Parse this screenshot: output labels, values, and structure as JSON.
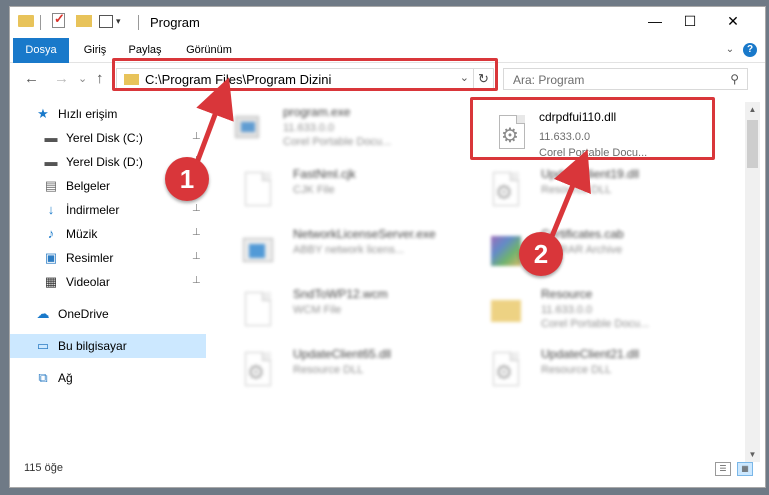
{
  "window": {
    "title": "Program",
    "minimize": "—",
    "maximize": "☐",
    "close": "✕"
  },
  "ribbon": {
    "tabs": [
      "Dosya",
      "Giriş",
      "Paylaş",
      "Görünüm"
    ],
    "expand": "⌄",
    "help": "?"
  },
  "navbar": {
    "back": "←",
    "forward": "→",
    "recent": "⌄",
    "up": "↑",
    "address": "C:\\Program Files\\Program Dizini",
    "address_dropdown": "⌄",
    "refresh": "↻",
    "search_placeholder": "Ara: Program",
    "search_icon": "⚲"
  },
  "sidebar": {
    "items": [
      {
        "label": "Hızlı erişim",
        "icon": "star-icon",
        "glyph": "★",
        "color": "#1979ca",
        "pinned": false
      },
      {
        "label": "Yerel Disk (C:)",
        "icon": "drive-icon",
        "glyph": "▬",
        "color": "#555555",
        "pinned": true
      },
      {
        "label": "Yerel Disk (D:)",
        "icon": "drive-icon",
        "glyph": "▬",
        "color": "#555555",
        "pinned": true
      },
      {
        "label": "Belgeler",
        "icon": "documents-icon",
        "glyph": "▤",
        "color": "#6d6d6d",
        "pinned": true
      },
      {
        "label": "İndirmeler",
        "icon": "download-icon",
        "glyph": "↓",
        "color": "#1979ca",
        "pinned": true
      },
      {
        "label": "Müzik",
        "icon": "music-icon",
        "glyph": "♪",
        "color": "#1979ca",
        "pinned": true
      },
      {
        "label": "Resimler",
        "icon": "pictures-icon",
        "glyph": "▣",
        "color": "#2d7dc4",
        "pinned": true
      },
      {
        "label": "Videolar",
        "icon": "videos-icon",
        "glyph": "▦",
        "color": "#333333",
        "pinned": true
      },
      {
        "label": "OneDrive",
        "icon": "cloud-icon",
        "glyph": "☁",
        "color": "#1979ca",
        "pinned": false
      },
      {
        "label": "Bu bilgisayar",
        "icon": "computer-icon",
        "glyph": "▭",
        "color": "#2d7dc4",
        "pinned": false,
        "selected": true
      },
      {
        "label": "Ağ",
        "icon": "network-icon",
        "glyph": "⧉",
        "color": "#2d7dc4",
        "pinned": false
      }
    ],
    "pin_glyph": "📌"
  },
  "files": [
    {
      "name": "program.exe",
      "line2": "11.633.0.0",
      "line3": "Corel Portable Docu...",
      "icon": "exe-icon",
      "blurred": true
    },
    {
      "name": "cdrpdfui110.dll",
      "line2": "11.633.0.0",
      "line3": "Corel Portable Docu...",
      "icon": "dll-gear-icon",
      "blurred": false
    },
    {
      "name": "FastNml.cjk",
      "line2": "CJK File",
      "line3": "",
      "icon": "document-icon",
      "blurred": true
    },
    {
      "name": "UpdateClient19.dll",
      "line2": "Resource DLL",
      "line3": "",
      "icon": "dll-gear-icon",
      "blurred": true
    },
    {
      "name": "NetworkLicenseServer.exe",
      "line2": "ABBY network licens...",
      "line3": "",
      "icon": "exe-icon",
      "blurred": true
    },
    {
      "name": "Certificates.cab",
      "line2": "WinRAR Archive",
      "line3": "",
      "icon": "archive-icon",
      "blurred": true
    },
    {
      "name": "SndToWP12.wcm",
      "line2": "WCM File",
      "line3": "",
      "icon": "document-icon",
      "blurred": true
    },
    {
      "name": "Resource",
      "line2": "11.633.0.0",
      "line3": "Corel Portable Docu...",
      "icon": "folder-icon",
      "blurred": true
    },
    {
      "name": "UpdateClient65.dll",
      "line2": "Resource DLL",
      "line3": "",
      "icon": "dll-gear-icon",
      "blurred": true
    },
    {
      "name": "UpdateClient21.dll",
      "line2": "Resource DLL",
      "line3": "",
      "icon": "dll-gear-icon",
      "blurred": true
    }
  ],
  "status": {
    "count": "115 öğe",
    "details_view": "☰",
    "icons_view": "▦"
  },
  "annotations": {
    "step1": "1",
    "step2": "2",
    "highlight_color": "#d9363a"
  },
  "scrollbar": {
    "up": "▲",
    "down": "▼"
  }
}
